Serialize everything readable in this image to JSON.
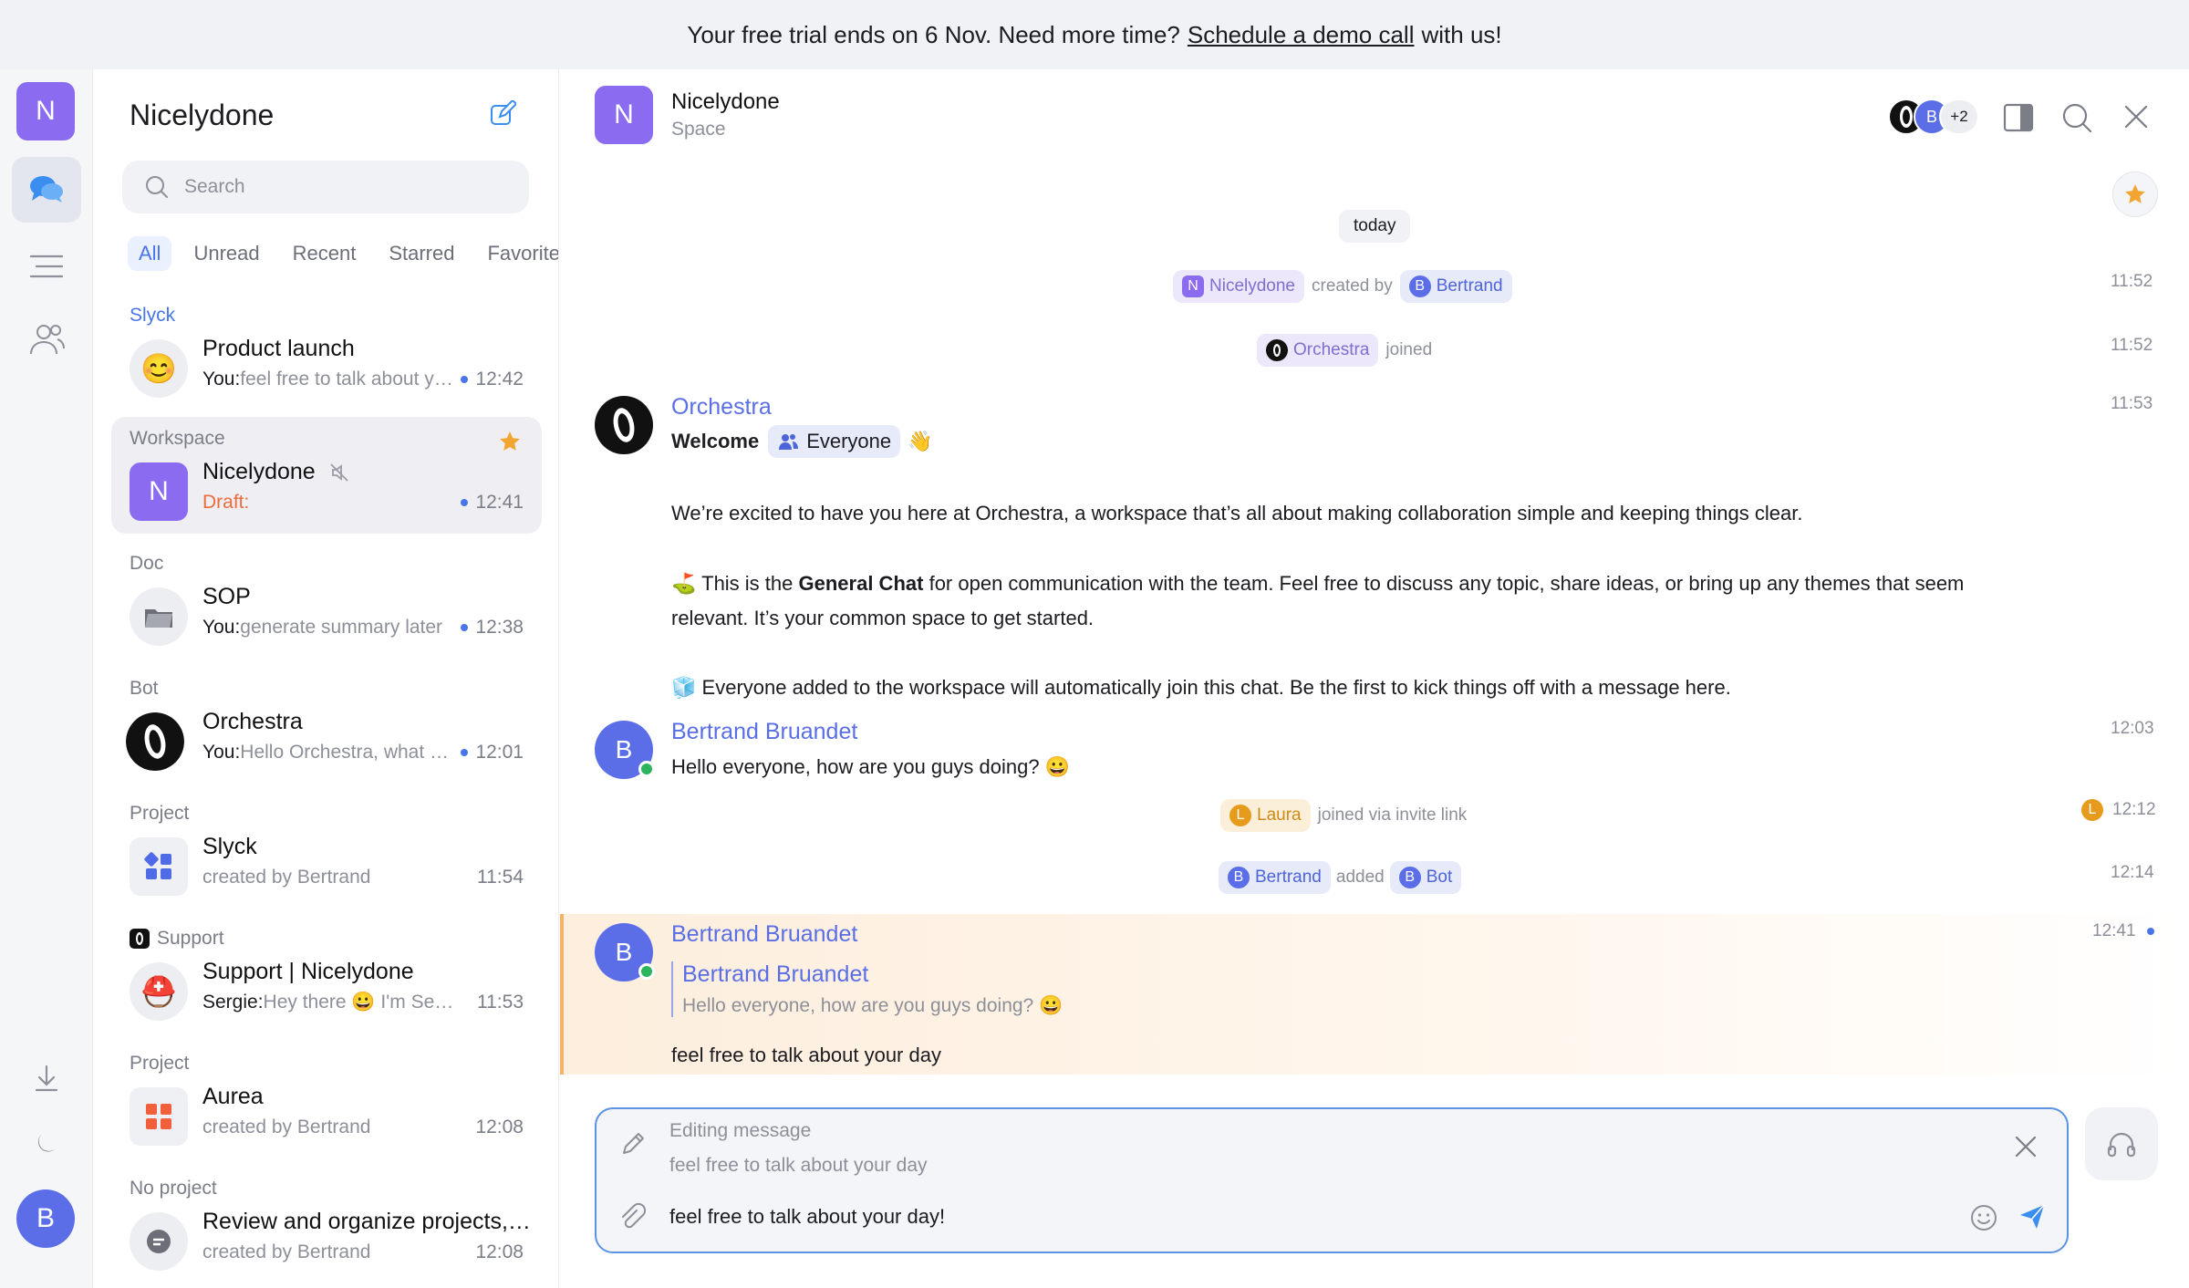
{
  "banner": {
    "prefix": "Your free trial ends on 6 Nov. Need more time?",
    "link": "Schedule a demo call",
    "suffix": "with us!"
  },
  "rail": {
    "workspace_initial": "N",
    "user_initial": "B"
  },
  "sidebar": {
    "title": "Nicelydone",
    "search_placeholder": "Search",
    "filters": [
      "All",
      "Unread",
      "Recent",
      "Starred",
      "Favorite"
    ],
    "conversations": [
      {
        "category": "Slyck",
        "name": "Product launch",
        "sender": "You:",
        "preview": "feel free to talk about your day",
        "time": "12:42",
        "unread": true
      },
      {
        "category": "Workspace",
        "name": "Nicelydone",
        "initial": "N",
        "draft": "Draft:",
        "time": "12:41",
        "unread": true,
        "starred": true,
        "muted": true
      },
      {
        "category": "Doc",
        "name": "SOP",
        "sender": "You:",
        "preview": "generate summary later",
        "time": "12:38",
        "unread": true
      },
      {
        "category": "Bot",
        "name": "Orchestra",
        "sender": "You:",
        "preview": "Hello Orchestra, what can you do?",
        "time": "12:01",
        "unread": true
      },
      {
        "category": "Project",
        "name": "Slyck",
        "preview": "created by Bertrand",
        "time": "11:54"
      },
      {
        "category": "Support",
        "name": "Support | Nicelydone",
        "sender": "Sergie:",
        "preview": "Hey there 😀 I'm Sergie",
        "time": "11:53"
      },
      {
        "category": "Project",
        "name": "Aurea",
        "preview": "created by Bertrand",
        "time": "12:08"
      },
      {
        "category": "No project",
        "name": "Review and organize projects, tasks",
        "preview": "created by Bertrand",
        "time": "12:08"
      }
    ]
  },
  "chat": {
    "title": "Nicelydone",
    "subtitle": "Space",
    "initial": "N",
    "member_extra": "+2",
    "member_initial": "B",
    "date_chip": "today",
    "events": {
      "created": {
        "space": "Nicelydone",
        "text": "created by",
        "user": "Bertrand",
        "time": "11:52"
      },
      "joined": {
        "user": "Orchestra",
        "text": "joined",
        "time": "11:52"
      },
      "laura": {
        "user": "Laura",
        "initial": "L",
        "text": "joined via invite link",
        "time": "12:12"
      },
      "added": {
        "user": "Bertrand",
        "text": "added",
        "target": "Bot",
        "time": "12:14"
      }
    },
    "welcome": {
      "author": "Orchestra",
      "time": "11:53",
      "bold": "Welcome",
      "mention": "Everyone",
      "wave": "👋",
      "p1": "We’re excited to have you here at Orchestra, a workspace that’s all about making collaboration simple and keeping things clear.",
      "p2_icon": "⛳",
      "p2_a": "This is the",
      "p2_bold": "General Chat",
      "p2_b": "for open communication with the team. Feel free to discuss any topic, share ideas, or bring up any themes that seem relevant. It’s your common space to get started.",
      "p3_icon": "🧊",
      "p3": "Everyone added to the workspace will automatically join this chat. Be the first to kick things off with a message here."
    },
    "msg1": {
      "author": "Bertrand Bruandet",
      "initial": "B",
      "text": "Hello everyone, how are you guys doing? 😀",
      "time": "12:03"
    },
    "msg2": {
      "author": "Bertrand Bruandet",
      "initial": "B",
      "quote_author": "Bertrand Bruandet",
      "quote_text": "Hello everyone, how are you guys doing? 😀",
      "text": "feel free to talk about your day",
      "time": "12:41"
    },
    "composer": {
      "label": "Editing message",
      "original": "feel free to talk about your day",
      "value": "feel free to talk about your day!"
    }
  },
  "colors": {
    "accent": "#8b6cf0",
    "blue": "#4876e8",
    "orange": "#f3a531"
  }
}
